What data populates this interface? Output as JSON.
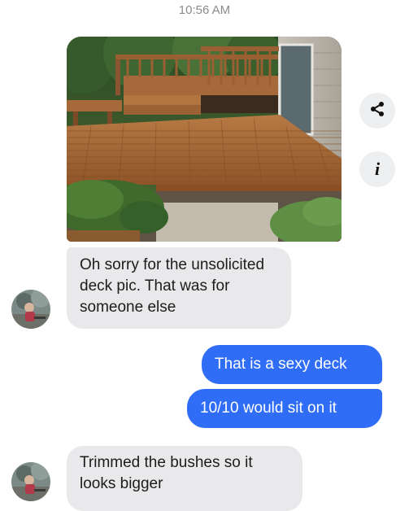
{
  "status": {
    "time": "10:56 AM"
  },
  "actions": {
    "share_icon": "share-icon",
    "info_icon": "info-icon",
    "info_glyph": "i"
  },
  "messages": [
    {
      "sender": "contact",
      "lines": [
        "Oh sorry for the unsolicited",
        "deck pic. That was for",
        "someone else"
      ]
    },
    {
      "sender": "me",
      "text": "That is a sexy deck"
    },
    {
      "sender": "me",
      "text": "10/10 would sit on it"
    },
    {
      "sender": "contact",
      "lines": [
        "Trimmed the bushes so it",
        "looks bigger"
      ]
    }
  ],
  "colors": {
    "outgoing_bubble": "#2f6df6",
    "incoming_bubble": "#e9e9eb",
    "timestamp_text": "#8a8a8a"
  }
}
